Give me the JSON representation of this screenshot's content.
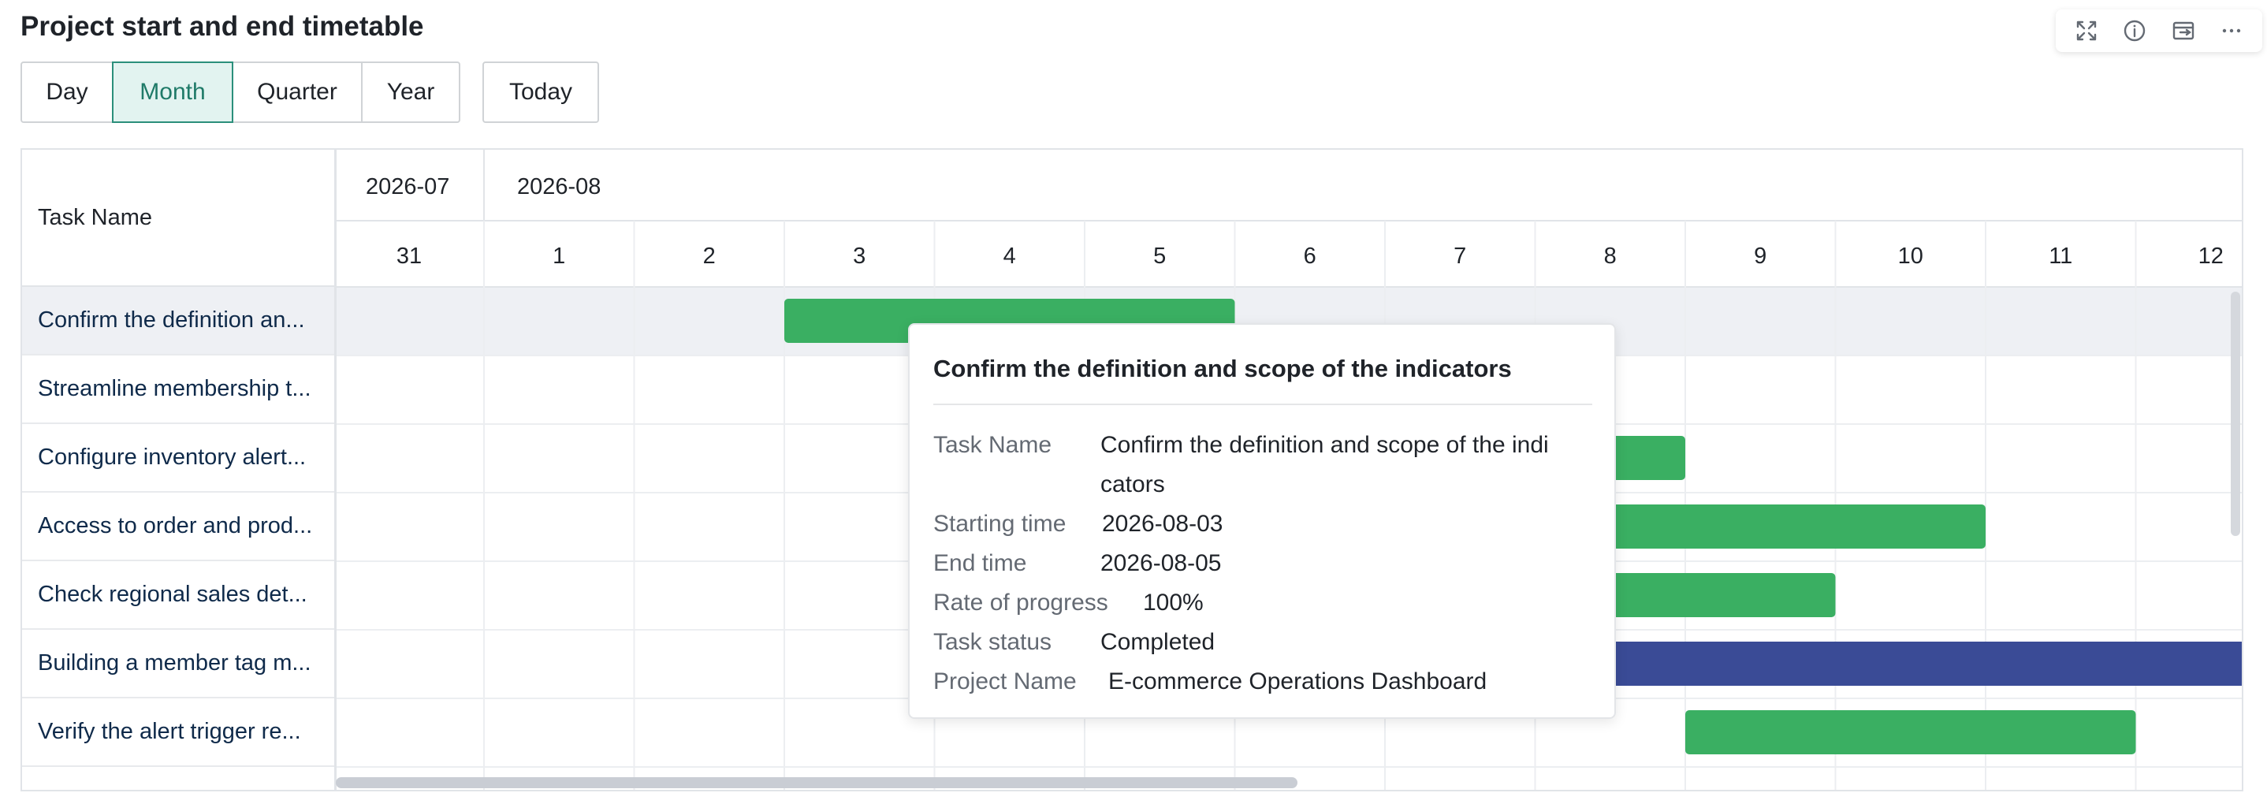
{
  "title": "Project start and end timetable",
  "toolbar": {
    "icons": [
      "fullscreen-icon",
      "info-icon",
      "export-icon",
      "more-icon"
    ]
  },
  "view_modes": [
    "Day",
    "Month",
    "Quarter",
    "Year"
  ],
  "active_view": "Month",
  "today_label": "Today",
  "table": {
    "task_header": "Task Name",
    "months": [
      "2026-07",
      "2026-08"
    ],
    "days": [
      "31",
      "1",
      "2",
      "3",
      "4",
      "5",
      "6",
      "7",
      "8",
      "9",
      "10",
      "11",
      "12"
    ],
    "tasks": [
      {
        "name": "Confirm the definition an...",
        "start": "2026-08-03",
        "end": "2026-08-05",
        "progress": 1.0,
        "color": "#3aaf62"
      },
      {
        "name": "Streamline membership t...",
        "start": "",
        "end": "",
        "progress": null,
        "color": "#3aaf62"
      },
      {
        "name": "Configure inventory alert...",
        "end": "2026-08-08",
        "progress": 1.0,
        "color": "#3aaf62"
      },
      {
        "name": "Access to order and prod...",
        "end": "2026-08-10",
        "progress": 1.0,
        "color": "#3aaf62"
      },
      {
        "name": "Check regional sales det...",
        "end": "2026-08-09",
        "progress": 1.0,
        "color": "#3aaf62"
      },
      {
        "name": "Building a member tag m...",
        "end": "2026-08-12",
        "progress": 0.75,
        "color": "#3a4b96",
        "track_color": "#c8cde8"
      },
      {
        "name": "Verify the alert trigger re...",
        "start": "2026-08-09",
        "end": "2026-08-11",
        "progress": 1.0,
        "color": "#3aaf62"
      }
    ]
  },
  "tooltip": {
    "title": "Confirm the definition and scope of the indicators",
    "task_name_key": "Task Name",
    "task_name_line1": "Confirm the definition and scope of the indi",
    "task_name_line2": "cators",
    "start_key": "Starting time",
    "start_val": "2026-08-03",
    "end_key": "End time",
    "end_val": "2026-08-05",
    "progress_key": "Rate of progress",
    "progress_val": "100%",
    "status_key": "Task status",
    "status_val": "Completed",
    "project_key": "Project Name",
    "project_val": "E-commerce Operations Dashboard"
  },
  "colors": {
    "accent": "#2b8f7b",
    "bar_done": "#3aaf62",
    "bar_partial": "#3a4b96",
    "bar_track": "#c8cde8"
  }
}
